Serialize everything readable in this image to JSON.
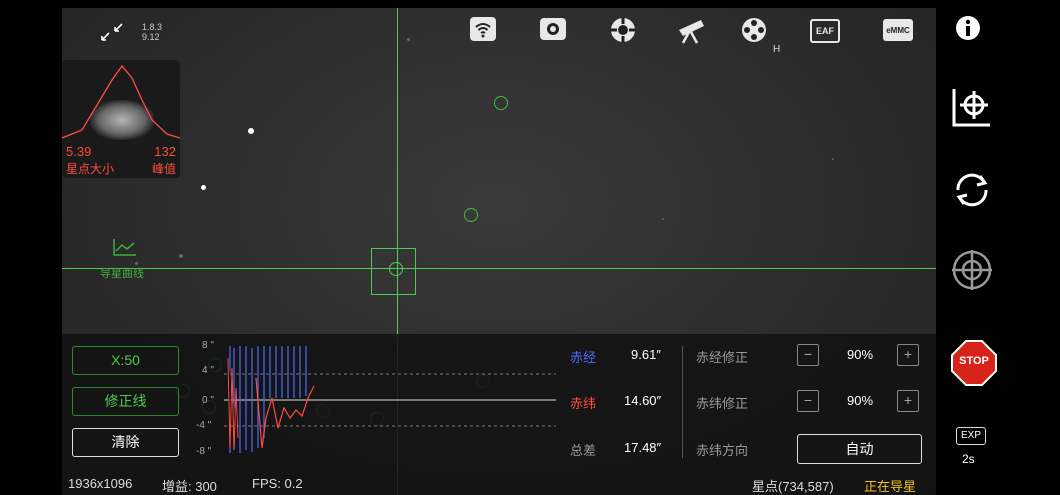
{
  "app": {
    "version_line1": "1.8.3",
    "version_line2": "9.12"
  },
  "toolbar": {
    "icons": [
      "wifi-icon",
      "camera-icon",
      "focuser-icon",
      "telescope-icon",
      "filter-wheel-icon",
      "eaf-icon",
      "emmc-icon"
    ],
    "filter_badge": "H",
    "eaf_label": "EAF",
    "emmc_label": "eMMC"
  },
  "star_profile": {
    "size_value": "5.39",
    "size_label": "星点大小",
    "peak_value": "132",
    "peak_label": "峰值"
  },
  "guide_curve": {
    "label": "导星曲线",
    "y_ticks": [
      "8 \"",
      "4 \"",
      "0 \"",
      "-4 \"",
      "-8 \""
    ]
  },
  "guide_controls": {
    "scale_button": "X:50",
    "correction_line_button": "修正线",
    "clear_button": "清除"
  },
  "stats": {
    "ra_label": "赤经",
    "ra_value": "9.61″",
    "dec_label": "赤纬",
    "dec_value": "14.60″",
    "total_label": "总差",
    "total_value": "17.48″"
  },
  "corrections": {
    "ra_corr_label": "赤经修正",
    "ra_corr_value": "90%",
    "dec_corr_label": "赤纬修正",
    "dec_corr_value": "90%",
    "dec_dir_label": "赤纬方向",
    "dec_dir_value": "自动",
    "minus": "−",
    "plus": "+"
  },
  "status_bar": {
    "resolution": "1936x1096",
    "gain": "增益: 300",
    "fps": "FPS: 0.2",
    "star_pos": "星点(734,587)",
    "guiding_status": "正在导星"
  },
  "right_sidebar": {
    "exp_label": "EXP",
    "exp_value": "2s",
    "stop_label": "STOP"
  },
  "colors": {
    "crosshair": "#4ccc4c",
    "ra": "#4a6cff",
    "dec": "#ff4d3d",
    "status_guiding": "#f0c020"
  }
}
